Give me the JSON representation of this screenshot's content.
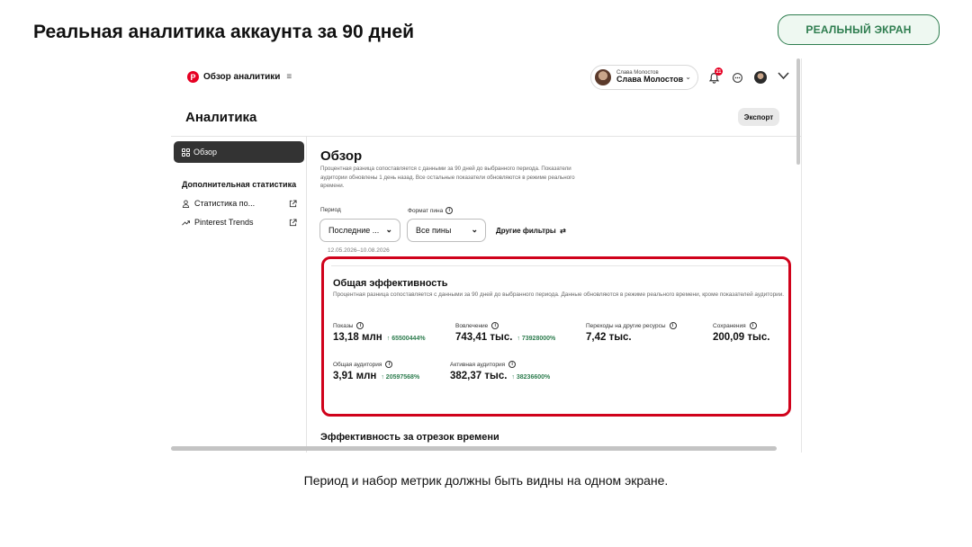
{
  "slide": {
    "title": "Реальная аналитика аккаунта за 90 дней",
    "badge": "РЕАЛЬНЫЙ ЭКРАН",
    "caption": "Период и набор метрик должны быть видны на одном экране."
  },
  "header": {
    "logo": "P",
    "brand": "Обзор аналитики",
    "menu_icon": "≡",
    "user_small": "Слава Молостов",
    "user_name": "Слава Молостов",
    "notifications_count": "21"
  },
  "page": {
    "title": "Аналитика",
    "export_label": "Экспорт"
  },
  "sidebar": {
    "active_item": "Обзор",
    "section_heading": "Дополнительная статистика",
    "items": [
      {
        "label": "Статистика по...",
        "icon": "person-icon"
      },
      {
        "label": "Pinterest Trends",
        "icon": "trend-icon"
      }
    ]
  },
  "main": {
    "title": "Обзор",
    "description": "Процентная разница сопоставляется с данными за 90 дней до выбранного периода. Показатели аудитории обновлены 1 день назад. Все остальные показатели обновляются в режиме реального времени.",
    "filters": {
      "period_label": "Период",
      "period_value": "Последние ...",
      "format_label": "Формат пина",
      "format_value": "Все пины",
      "more_filters": "Другие фильтры",
      "date_range": "12.05.2026–10.08.2026"
    },
    "card": {
      "title": "Общая эффективность",
      "description": "Процентная разница сопоставляется с данными за 90 дней до выбранного периода. Данные обновляются в режиме реального времени, кроме показателей аудитории.",
      "metrics": [
        {
          "label": "Показы",
          "value": "13,18 млн",
          "change": "65500444%"
        },
        {
          "label": "Вовлечение",
          "value": "743,41 тыс.",
          "change": "73928000%"
        },
        {
          "label": "Переходы на другие ресурсы",
          "value": "7,42 тыс.",
          "change": ""
        },
        {
          "label": "Сохранения",
          "value": "200,09 тыс.",
          "change": ""
        },
        {
          "label": "Общая аудитория",
          "value": "3,91 млн",
          "change": "20597568%"
        },
        {
          "label": "Активная аудитория",
          "value": "382,37 тыс.",
          "change": "38236600%"
        }
      ]
    },
    "next_section_title": "Эффективность за отрезок времени"
  },
  "colors": {
    "accent_red": "#e60023",
    "highlight_border": "#d0021b",
    "positive_green": "#2e7d4f",
    "badge_bg": "#eef8f1"
  }
}
